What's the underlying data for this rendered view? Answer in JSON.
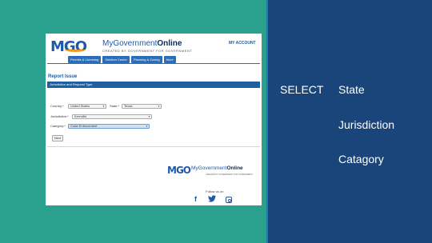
{
  "colors": {
    "background_teal": "#2aa08f",
    "panel_navy": "#19457a",
    "brand_blue": "#1f5aa8",
    "brand_orange": "#f29a1d"
  },
  "header": {
    "logo_letters": [
      "M",
      "G",
      "O"
    ],
    "brand_prefix": "MyGovernment",
    "brand_suffix": "Online",
    "tagline": "CREATED BY GOVERNMENT FOR GOVERNMENT",
    "my_account": "MY ACCOUNT",
    "nav": [
      "Permits & Licensing",
      "Solution Center",
      "Planning & Zoning",
      "More"
    ]
  },
  "report": {
    "title": "Report Issue",
    "section_bar": "Jurisdiction and Request Type",
    "country_label": "Country:",
    "country_value": "United States",
    "state_label": "State:",
    "state_value": "Texas",
    "jurisdiction_label": "Jurisdiction:",
    "jurisdiction_value": "Kernville",
    "category_label": "Category:",
    "category_value": "Code Enforcement",
    "required_mark": "*",
    "next_button": "Next"
  },
  "footer": {
    "logo_letters": "MGO",
    "brand_prefix": "MyGovernment",
    "brand_suffix": "Online",
    "tagline": "CREATED BY GOVERNMENT FOR GOVERNMENT",
    "follow_label": "Follow us on",
    "social_icons": [
      "facebook-icon",
      "twitter-icon",
      "instagram-icon"
    ]
  },
  "panel": {
    "select_label": "SELECT",
    "items": [
      "State",
      "Jurisdiction",
      "Catagory"
    ]
  }
}
